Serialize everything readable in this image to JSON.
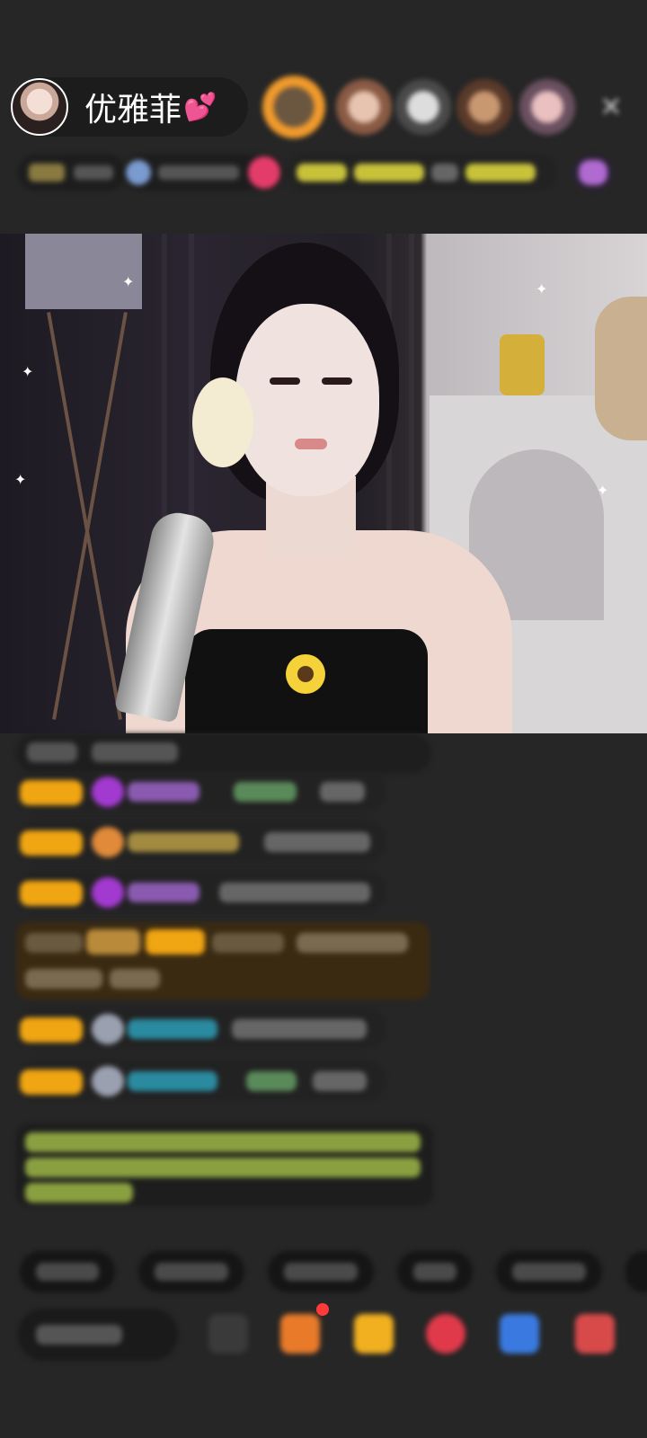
{
  "host": {
    "name": "优雅菲",
    "heart": "💕"
  },
  "header": {
    "close_label": "✕"
  },
  "colors": {
    "background": "#262626",
    "badge_gold": "#f0a512",
    "name_purple": "#b16de0",
    "name_teal": "#2ab8c8",
    "announce_green": "#c6e65a",
    "gift_red": "#ff3a3a"
  },
  "icons": {
    "close": "close-icon",
    "chat_bubble": "chat-icon",
    "gift": "gift-icon",
    "heart": "heart-icon"
  }
}
